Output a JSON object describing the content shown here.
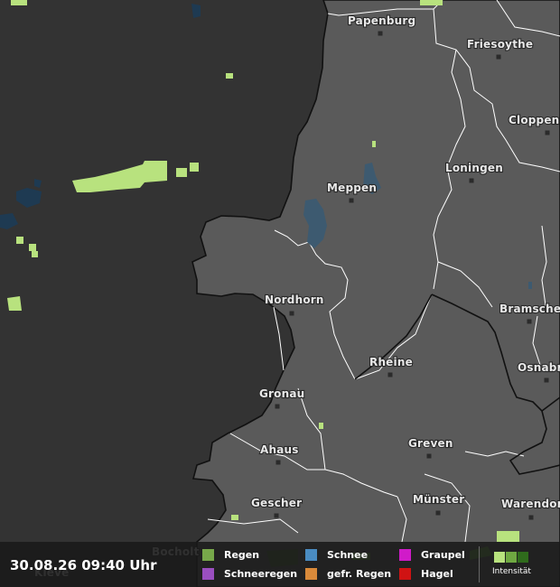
{
  "map": {
    "colors": {
      "outside": "#333333",
      "inside": "#5a5a5a",
      "water": "#3d5a70",
      "rain_light": "#b8e27e",
      "border": "#111111",
      "district_line": "#ffffff"
    },
    "cities": [
      {
        "name": "Papenburg",
        "key": "papenburg"
      },
      {
        "name": "Friesoythe",
        "key": "friesoythe"
      },
      {
        "name": "Cloppen",
        "key": "cloppen"
      },
      {
        "name": "Loningen",
        "key": "loningen"
      },
      {
        "name": "Meppen",
        "key": "meppen"
      },
      {
        "name": "Nordhorn",
        "key": "nordhorn"
      },
      {
        "name": "Bramsche",
        "key": "bramsche"
      },
      {
        "name": "Rheine",
        "key": "rheine"
      },
      {
        "name": "Osnabr",
        "key": "osnabr"
      },
      {
        "name": "Gronau",
        "key": "gronau"
      },
      {
        "name": "Ahaus",
        "key": "ahaus"
      },
      {
        "name": "Greven",
        "key": "greven"
      },
      {
        "name": "Münster",
        "key": "muenster"
      },
      {
        "name": "Gescher",
        "key": "gescher"
      },
      {
        "name": "Warendor",
        "key": "warendor"
      },
      {
        "name": "Bocholt",
        "key": "bocholt"
      },
      {
        "name": "Kleve",
        "key": "kleve"
      }
    ]
  },
  "footer": {
    "timestamp": "30.08.26 09:40 Uhr",
    "legend": [
      {
        "label": "Regen",
        "color": "#77a84a"
      },
      {
        "label": "Schneeregen",
        "color": "#9a4fc0"
      },
      {
        "label": "Schnee",
        "color": "#4a8cc2"
      },
      {
        "label": "gefr. Regen",
        "color": "#d98a3a"
      },
      {
        "label": "Graupel",
        "color": "#d01bc9"
      },
      {
        "label": "Hagel",
        "color": "#d01313"
      }
    ],
    "intensity_label": "Intensität",
    "intensity_colors": [
      "#b8e27e",
      "#6fa842",
      "#2f6b1c"
    ]
  }
}
